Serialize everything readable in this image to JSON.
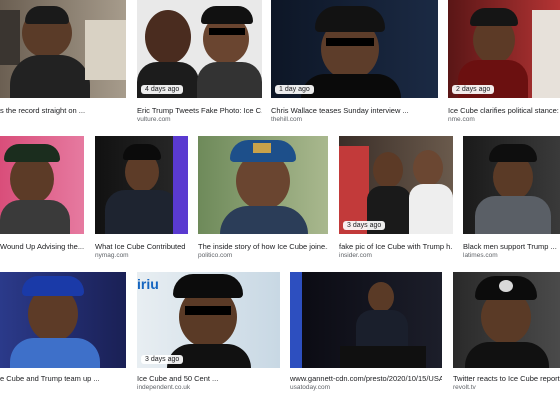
{
  "results": [
    {
      "row": 1,
      "title": "s the record straight on ...",
      "source": "",
      "badge": ""
    },
    {
      "row": 1,
      "title": "Eric Trump Tweets Fake Photo: Ice C...",
      "source": "vulture.com",
      "badge": "4 days ago"
    },
    {
      "row": 1,
      "title": "Chris Wallace teases Sunday interview ...",
      "source": "thehill.com",
      "badge": "1 day ago"
    },
    {
      "row": 1,
      "title": "Ice Cube clarifies political stance: \"I ...",
      "source": "nme.com",
      "badge": "2 days ago"
    },
    {
      "row": 2,
      "title": "Wound Up Advising the...",
      "source": "",
      "badge": ""
    },
    {
      "row": 2,
      "title": "What Ice Cube Contributed ...",
      "source": "nymag.com",
      "badge": ""
    },
    {
      "row": 2,
      "title": "The inside story of how Ice Cube joine...",
      "source": "politico.com",
      "badge": ""
    },
    {
      "row": 2,
      "title": "fake pic of Ice Cube with Trump h...",
      "source": "insider.com",
      "badge": "3 days ago"
    },
    {
      "row": 2,
      "title": "Black men support Trump ...",
      "source": "latimes.com",
      "badge": ""
    },
    {
      "row": 3,
      "title": "e Cube and Trump team up ...",
      "source": "",
      "badge": ""
    },
    {
      "row": 3,
      "title": "Ice Cube and 50 Cent ...",
      "source": "independent.co.uk",
      "badge": "3 days ago"
    },
    {
      "row": 3,
      "title": "www.gannett-cdn.com/presto/2020/10/15/USA...",
      "source": "usatoday.com",
      "badge": ""
    },
    {
      "row": 3,
      "title": "Twitter reacts to Ice Cube reported...",
      "source": "revolt.tv",
      "badge": ""
    }
  ]
}
